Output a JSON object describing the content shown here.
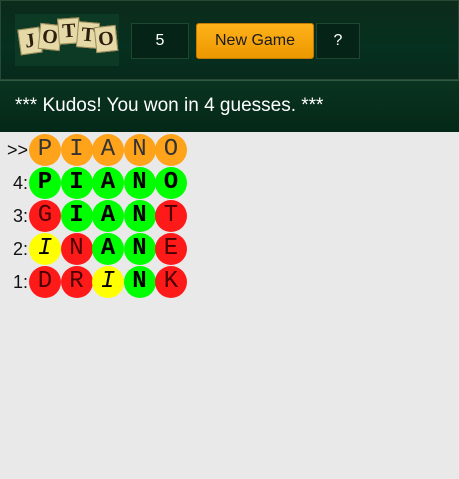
{
  "header": {
    "logo_letters": [
      "J",
      "O",
      "T",
      "T",
      "O"
    ],
    "letter_count": "5",
    "new_game_label": "New Game",
    "help_label": "?"
  },
  "status": {
    "message": "*** Kudos! You won in 4 guesses. ***"
  },
  "colors": {
    "orange": "#ffa31a",
    "green": "#00ff00",
    "red": "#ff1a1a",
    "yellow": "#ffff00"
  },
  "board": {
    "rows": [
      {
        "label": ">>",
        "letters": [
          "P",
          "I",
          "A",
          "N",
          "O"
        ],
        "states": [
          "orange",
          "orange",
          "orange",
          "orange",
          "orange"
        ]
      },
      {
        "label": "4:",
        "letters": [
          "P",
          "I",
          "A",
          "N",
          "O"
        ],
        "states": [
          "green",
          "green",
          "green",
          "green",
          "green"
        ]
      },
      {
        "label": "3:",
        "letters": [
          "G",
          "I",
          "A",
          "N",
          "T"
        ],
        "states": [
          "red",
          "green",
          "green",
          "green",
          "red"
        ]
      },
      {
        "label": "2:",
        "letters": [
          "I",
          "N",
          "A",
          "N",
          "E"
        ],
        "states": [
          "yellow",
          "red",
          "green",
          "green",
          "red"
        ]
      },
      {
        "label": "1:",
        "letters": [
          "D",
          "R",
          "I",
          "N",
          "K"
        ],
        "states": [
          "red",
          "red",
          "yellow",
          "green",
          "red"
        ]
      }
    ]
  }
}
